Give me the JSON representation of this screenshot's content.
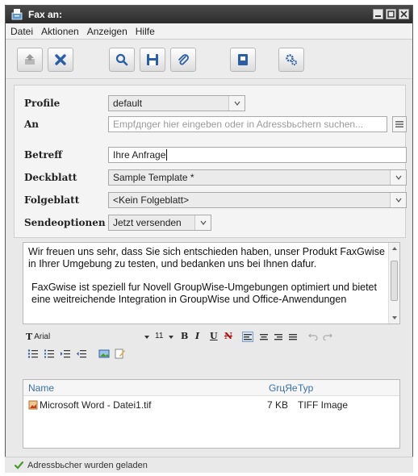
{
  "window": {
    "title": "Fax an:"
  },
  "menu": [
    "Datei",
    "Aktionen",
    "Anzeigen",
    "Hilfe"
  ],
  "toolbar": [
    "send-icon",
    "close-icon",
    "search-icon",
    "save-icon",
    "attach-icon",
    "addressbook-icon",
    "settings-icon"
  ],
  "form": {
    "profile_label": "Profile",
    "profile_value": "default",
    "to_label": "An",
    "to_placeholder": "Empfдnger hier eingeben oder in Adressbьchern suchen...",
    "subject_label": "Betreff",
    "subject_value": "Ihre Anfrage",
    "cover_label": "Deckblatt",
    "cover_value": "Sample Template *",
    "follow_label": "Folgeblatt",
    "follow_value": "<Kein Folgeblatt>",
    "send_label": "Sendeoptionen",
    "send_value": "Jetzt versenden"
  },
  "body": {
    "para1": "Wir freuen uns sehr, dass Sie sich entschieden haben, unser Produkt FaxGwise in Ihrer Umgebung zu testen, und bedanken uns bei Ihnen dafur.",
    "para2": "FaxGwise ist speziell fur Novell GroupWise-Umgebungen optimiert und bietet eine weitreichende Integration in GroupWise und Office-Anwendungen"
  },
  "format": {
    "font": "Arial",
    "size": "11",
    "bold": "B",
    "italic": "I",
    "underline": "U",
    "strike": "N"
  },
  "attachments": {
    "columns": [
      "Name",
      "GrцЯe",
      "Typ"
    ],
    "rows": [
      {
        "name": "Microsoft Word - Datei1.tif",
        "size": "7 KB",
        "type": "TIFF Image"
      }
    ]
  },
  "status": {
    "message": "Adressbьcher wurden geladen"
  },
  "colors": {
    "titlebar": "#333333",
    "accent": "#3a6ea5",
    "close_red": "#c0392b",
    "check_green": "#4a9a2a"
  }
}
